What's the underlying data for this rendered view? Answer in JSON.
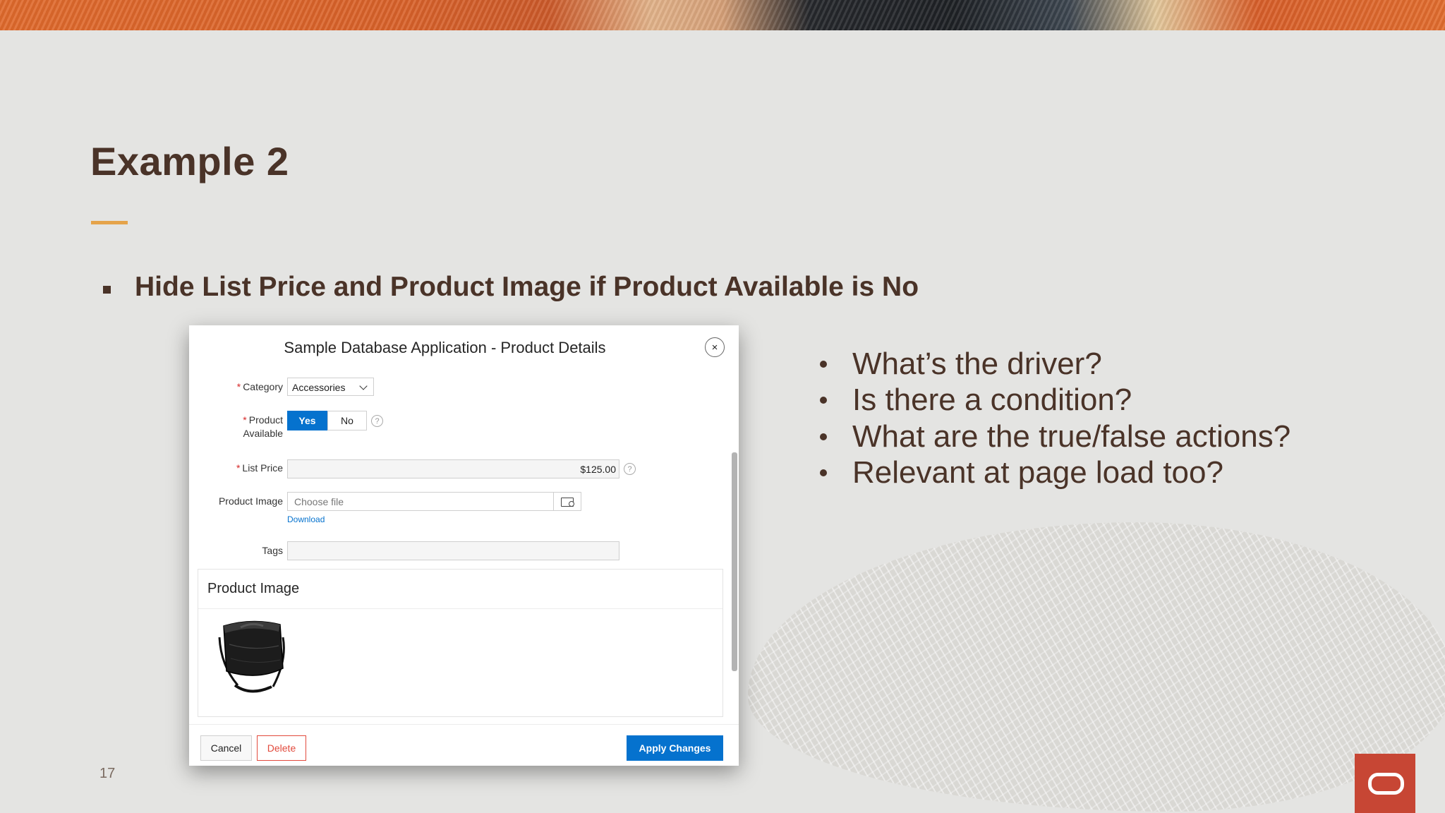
{
  "slide": {
    "title": "Example 2",
    "main_bullet": "Hide List Price and Product Image if Product Available is No",
    "questions": [
      "What’s the driver?",
      "Is there a condition?",
      "What are the true/false actions?",
      "Relevant at page load too?"
    ],
    "page_number": "17"
  },
  "dialog": {
    "title": "Sample Database Application - Product Details",
    "close_glyph": "×",
    "help_glyph": "?",
    "category": {
      "label": "Category",
      "value": "Accessories"
    },
    "product_available": {
      "label_line1": "Product",
      "label_line2": "Available",
      "yes": "Yes",
      "no": "No",
      "selected": "Yes"
    },
    "list_price": {
      "label": "List Price",
      "value": "$125.00"
    },
    "product_image": {
      "label": "Product Image",
      "placeholder": "Choose file",
      "download": "Download"
    },
    "tags": {
      "label": "Tags",
      "value": ""
    },
    "region": {
      "title": "Product Image",
      "image": "black-handbag"
    },
    "buttons": {
      "cancel": "Cancel",
      "delete": "Delete",
      "apply": "Apply Changes"
    }
  },
  "colors": {
    "heading": "#4a3328",
    "accent_rule": "#e5a34a",
    "primary_button": "#0572ce",
    "delete_button": "#e24a3c",
    "required_marker": "#d62828",
    "logo_bg": "#c74634"
  }
}
